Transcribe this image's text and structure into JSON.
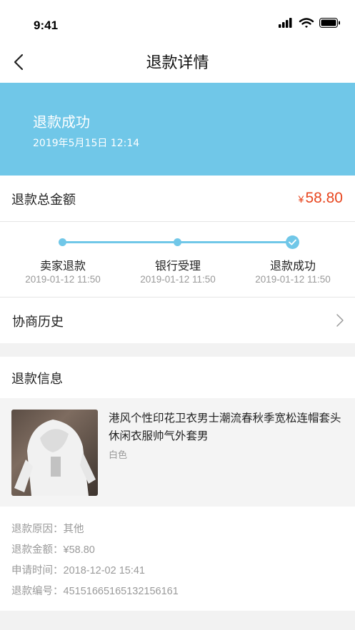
{
  "status_bar": {
    "time": "9:41"
  },
  "nav": {
    "title": "退款详情",
    "back_icon": "chevron-left-icon"
  },
  "banner": {
    "title": "退款成功",
    "date": "2019年5月15日  12:14",
    "color": "#70c7e8"
  },
  "total": {
    "label": "退款总金额",
    "currency": "¥",
    "value": "58.80",
    "color": "#e8461f"
  },
  "progress": {
    "steps": [
      {
        "label": "卖家退款",
        "time": "2019-01-12 11:50"
      },
      {
        "label": "银行受理",
        "time": "2019-01-12 11:50"
      },
      {
        "label": "退款成功",
        "time": "2019-01-12 11:50"
      }
    ]
  },
  "history": {
    "label": "协商历史"
  },
  "refund_info": {
    "heading": "退款信息",
    "product": {
      "title": "港风个性印花卫衣男士潮流春秋季宽松连帽套头休闲衣服帅气外套男",
      "sku": "白色"
    },
    "details": [
      {
        "label": "退款原因：",
        "value": "其他"
      },
      {
        "label": "退款金额：",
        "value": "¥58.80"
      },
      {
        "label": "申请时间：",
        "value": "2018-12-02   15:41"
      },
      {
        "label": "退款编号：",
        "value": "45151665165132156161"
      }
    ]
  }
}
